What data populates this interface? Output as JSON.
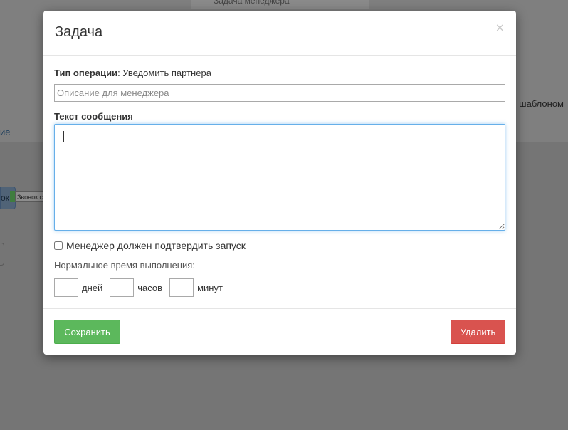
{
  "background": {
    "top_text": "Задача менеджера",
    "template_text": "шаблоном",
    "link_text": "ие",
    "node_text": "ок",
    "tag_text": "Звонок с"
  },
  "modal": {
    "title": "Задача",
    "close_symbol": "×",
    "operation_label": "Тип операции",
    "operation_value": ": Уведомить партнера",
    "description_placeholder": "Описание для менеджера",
    "description_value": "",
    "message_label": "Текст сообщения",
    "message_value": "",
    "confirm_label": "Менеджер должен подтвердить запуск",
    "time_label": "Нормальное время выполнения:",
    "days_label": "дней",
    "hours_label": "часов",
    "minutes_label": "минут",
    "save_label": "Сохранить",
    "delete_label": "Удалить"
  },
  "colors": {
    "save": "#5cb85c",
    "delete": "#d9534f",
    "focus": "#66afe9"
  }
}
